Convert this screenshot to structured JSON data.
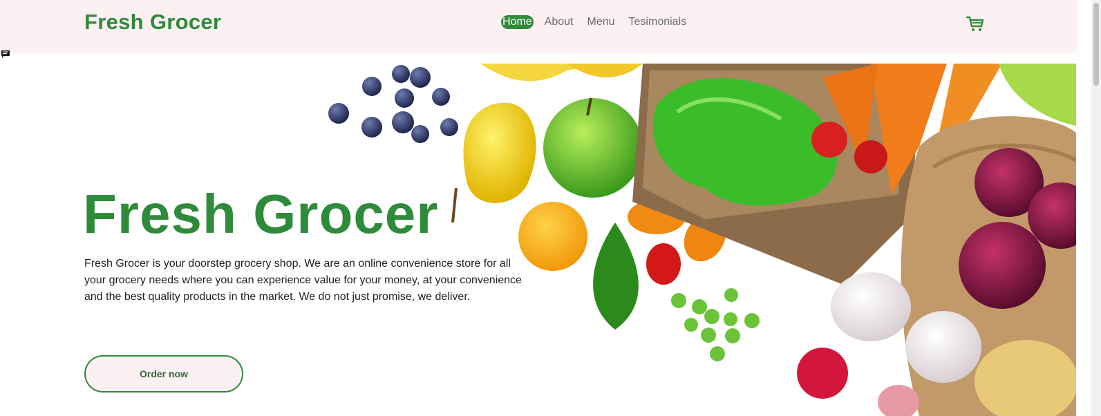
{
  "header": {
    "brand": "Fresh Grocer",
    "nav": [
      {
        "label": "Home"
      },
      {
        "label": "About"
      },
      {
        "label": "Menu"
      },
      {
        "label": "Tesimonials"
      }
    ],
    "cart_icon": "cart-icon"
  },
  "hero": {
    "title": "Fresh Grocer",
    "description": "Fresh Grocer is your doorstep grocery shop. We are an online convenience store for all your grocery needs where you can experience value for your money, at your convenience and the best quality products in the market. We do not just promise, we deliver.",
    "cta_label": "Order now"
  },
  "colors": {
    "brand_green": "#2e8b3a",
    "header_bg": "#fdf0f3",
    "text": "#1f1f1f",
    "nav_text": "#6b6b6b"
  }
}
